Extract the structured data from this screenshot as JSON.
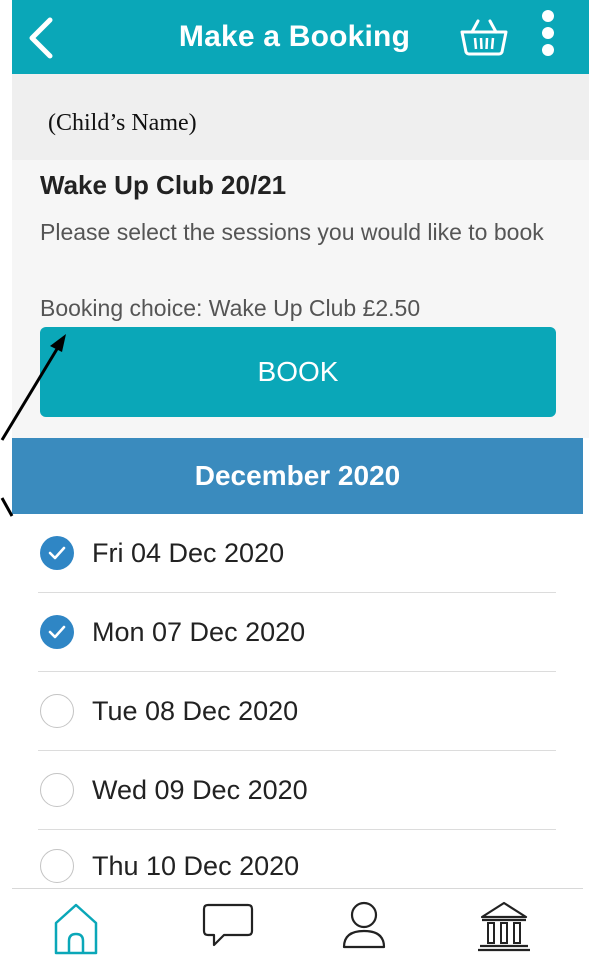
{
  "header": {
    "title": "Make a Booking",
    "back_icon": "chevron-left-icon",
    "basket_icon": "basket-icon",
    "more_icon": "more-vertical-icon",
    "accent_color": "#0aa7b8"
  },
  "child": {
    "name": "(Child’s Name)"
  },
  "booking": {
    "club_title": "Wake Up Club 20/21",
    "instruction": "Please select the sessions you would like to book",
    "choice": "Booking choice: Wake Up Club £2.50",
    "book_label": "BOOK"
  },
  "calendar": {
    "month": "December 2020",
    "month_color": "#3a8bbe",
    "sessions": [
      {
        "label": "Fri 04 Dec 2020",
        "selected": true
      },
      {
        "label": "Mon 07 Dec 2020",
        "selected": true
      },
      {
        "label": "Tue 08 Dec 2020",
        "selected": false
      },
      {
        "label": "Wed 09 Dec 2020",
        "selected": false
      },
      {
        "label": "Thu 10 Dec 2020",
        "selected": false
      }
    ]
  },
  "tabs": [
    {
      "icon": "home-icon"
    },
    {
      "icon": "chat-icon"
    },
    {
      "icon": "user-icon"
    },
    {
      "icon": "bank-icon"
    }
  ]
}
